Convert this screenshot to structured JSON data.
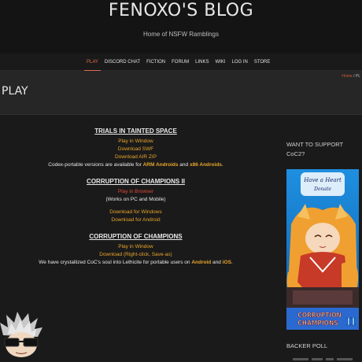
{
  "header": {
    "title": "FENOXO'S BLOG",
    "tagline": "Home of NSFW Ramblings"
  },
  "nav": {
    "items": [
      {
        "label": "PLAY",
        "active": true
      },
      {
        "label": "DISCORD CHAT"
      },
      {
        "label": "FICTION"
      },
      {
        "label": "FORUM"
      },
      {
        "label": "LINKS"
      },
      {
        "label": "WIKI"
      },
      {
        "label": "LOG IN"
      },
      {
        "label": "STORE"
      }
    ]
  },
  "breadcrumb": {
    "home": "Home",
    "sep": " / ",
    "current": "PL"
  },
  "page_title": "PLAY",
  "sections": {
    "tits": {
      "title": "TRIALS IN TAINTED SPACE",
      "play_window": "Play in Window",
      "download_swf": "Download SWF",
      "download_air": "Download AIR ZIP",
      "codex_pre": "Codex-portable versions are available for ",
      "codex_arm": "ARM Androids",
      "codex_and": " and ",
      "codex_x86": "x86 Androids",
      "codex_end": "."
    },
    "coc2": {
      "title": "CORRUPTION OF CHAMPIONS II",
      "play_browser": "Play in Browser",
      "works_on": "(Works on PC and Mobile)",
      "download_windows": "Download for Windows",
      "download_android": "Download for Android"
    },
    "coc": {
      "title": "CORRUPTION OF CHAMPIONS",
      "play_window": "Play in Window",
      "download": "Download (Right-click, Save-as)",
      "lethicite_pre": "We have crystallized CoC's soul into Lethicite for portable users on ",
      "lethicite_android": "Android",
      "lethicite_and": " and ",
      "lethicite_ios": "iOS",
      "lethicite_end": "."
    }
  },
  "sidebar": {
    "support_title": "WANT TO SUPPORT CoC2?",
    "banner_top_text": "Have a Heart Donate",
    "banner_bottom_text": "CORRUPTION CHAMPIONS",
    "banner_roman": "II",
    "backer_title": "BACKER POLL"
  },
  "colors": {
    "accent": "#e06a4a",
    "link": "#e8a52c",
    "link_red": "#e04a3a",
    "background": "#1a1a1a"
  }
}
